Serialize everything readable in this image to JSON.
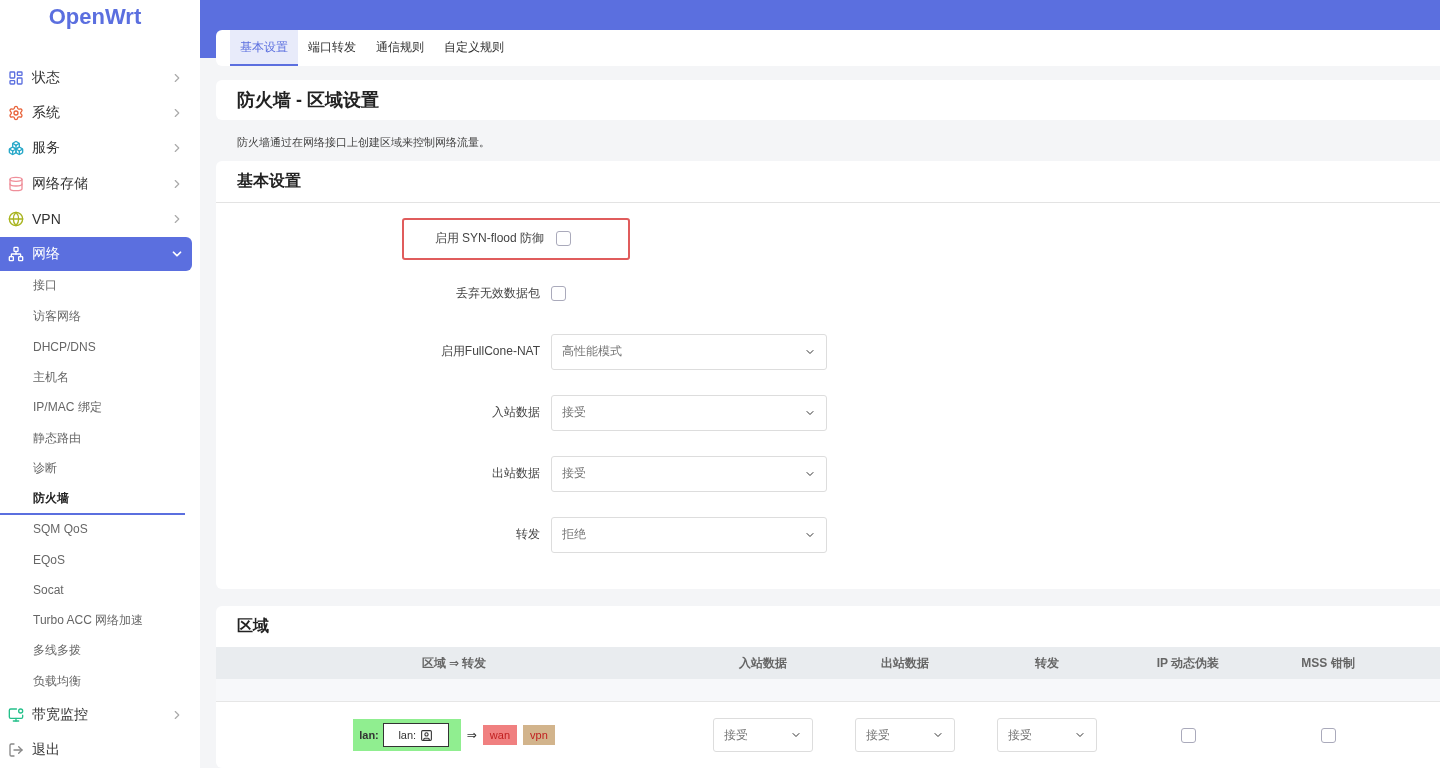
{
  "brand": "OpenWrt",
  "sidebar": {
    "items": [
      {
        "label": "状态",
        "kind": "group",
        "expanded": false
      },
      {
        "label": "系统",
        "kind": "group",
        "expanded": false
      },
      {
        "label": "服务",
        "kind": "group",
        "expanded": false
      },
      {
        "label": "网络存储",
        "kind": "group",
        "expanded": false
      },
      {
        "label": "VPN",
        "kind": "group",
        "expanded": false
      },
      {
        "label": "网络",
        "kind": "group",
        "expanded": true,
        "children": [
          {
            "label": "接口",
            "selected": false
          },
          {
            "label": "访客网络",
            "selected": false
          },
          {
            "label": "DHCP/DNS",
            "selected": false
          },
          {
            "label": "主机名",
            "selected": false
          },
          {
            "label": "IP/MAC 绑定",
            "selected": false
          },
          {
            "label": "静态路由",
            "selected": false
          },
          {
            "label": "诊断",
            "selected": false
          },
          {
            "label": "防火墙",
            "selected": true
          },
          {
            "label": "SQM QoS",
            "selected": false
          },
          {
            "label": "EQoS",
            "selected": false
          },
          {
            "label": "Socat",
            "selected": false
          },
          {
            "label": "Turbo ACC 网络加速",
            "selected": false
          },
          {
            "label": "多线多拨",
            "selected": false
          },
          {
            "label": "负载均衡",
            "selected": false
          }
        ]
      },
      {
        "label": "带宽监控",
        "kind": "group",
        "expanded": false
      },
      {
        "label": "退出",
        "kind": "link"
      }
    ]
  },
  "tabs": [
    {
      "label": "基本设置",
      "selected": true
    },
    {
      "label": "端口转发",
      "selected": false
    },
    {
      "label": "通信规则",
      "selected": false
    },
    {
      "label": "自定义规则",
      "selected": false
    }
  ],
  "page_title": "防火墙 - 区域设置",
  "description": "防火墙通过在网络接口上创建区域来控制网络流量。",
  "basic_settings": {
    "title": "基本设置",
    "rows": [
      {
        "label": "启用 SYN-flood 防御",
        "kind": "checkbox",
        "checked": false,
        "highlighted": true
      },
      {
        "label": "丢弃无效数据包",
        "kind": "checkbox",
        "checked": false,
        "highlighted": false
      },
      {
        "label": "启用FullCone-NAT",
        "kind": "select",
        "value": "高性能模式",
        "highlighted": false
      },
      {
        "label": "入站数据",
        "kind": "select",
        "value": "接受",
        "highlighted": false
      },
      {
        "label": "出站数据",
        "kind": "select",
        "value": "接受",
        "highlighted": false
      },
      {
        "label": "转发",
        "kind": "select",
        "value": "拒绝",
        "highlighted": false
      }
    ]
  },
  "zones": {
    "title": "区域",
    "columns": [
      "区域 ⇒ 转发",
      "入站数据",
      "出站数据",
      "转发",
      "IP 动态伪装",
      "MSS 钳制"
    ],
    "rows": [
      {
        "zone": {
          "label": "lan:",
          "color": "#90ee90",
          "field": "lan:"
        },
        "arrow": "⇒",
        "targets": [
          {
            "label": "wan",
            "color": "#f08080"
          },
          {
            "label": "vpn",
            "color": "#d2b48c"
          }
        ],
        "input": "接受",
        "output": "接受",
        "forward": "接受",
        "masquerade": false,
        "mss_clamping": false
      }
    ]
  }
}
